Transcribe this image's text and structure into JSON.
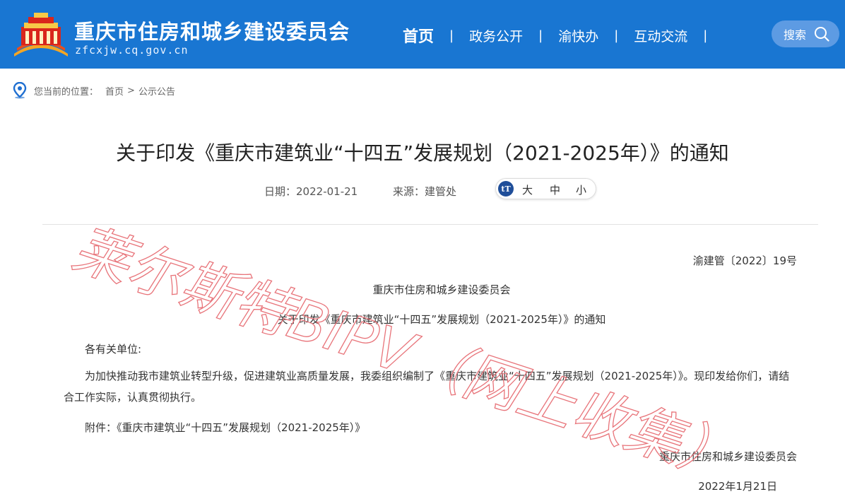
{
  "header": {
    "site_title": "重庆市住房和城乡建设委员会",
    "site_domain": "zfcxjw.cq.gov.cn",
    "nav": [
      {
        "label": "首页"
      },
      {
        "label": "政务公开"
      },
      {
        "label": "渝快办"
      },
      {
        "label": "互动交流"
      }
    ],
    "nav_separator": "|",
    "search_label": "搜索",
    "colors": {
      "background": "#1976d2",
      "search_bg": "#5d9be3"
    }
  },
  "breadcrumb": {
    "prefix": "您当前的位置：",
    "home": "首页",
    "separator": ">",
    "current": "公示公告",
    "icon": "location-pin-icon"
  },
  "article": {
    "title": "关于印发《重庆市建筑业“十四五”发展规划（2021-2025年）》的通知",
    "date_label": "日期：",
    "date": "2022-01-21",
    "source_label": "来源：",
    "source": "建管处",
    "font_size_options": {
      "large": "大",
      "medium": "中",
      "small": "小"
    },
    "font_icon": "tT"
  },
  "doc": {
    "number": "渝建管〔2022〕19号",
    "issuer": "重庆市住房和城乡建设委员会",
    "subtitle": "关于印发《重庆市建筑业“十四五”发展规划（2021-2025年）》的通知",
    "salutation": "各有关单位:",
    "body": "为加快推动我市建筑业转型升级，促进建筑业高质量发展，我委组织编制了《重庆市建筑业“十四五”发展规划（2021-2025年）》。现印发给你们，请结合工作实际，认真贯彻执行。",
    "attachment": "附件：《重庆市建筑业“十四五”发展规划（2021-2025年）》",
    "signature": "重庆市住房和城乡建设委员会",
    "sign_date": "2022年1月21日"
  },
  "watermark": {
    "text": "莱尔斯特BIPV（网上收集）",
    "color": "#e8747a"
  }
}
